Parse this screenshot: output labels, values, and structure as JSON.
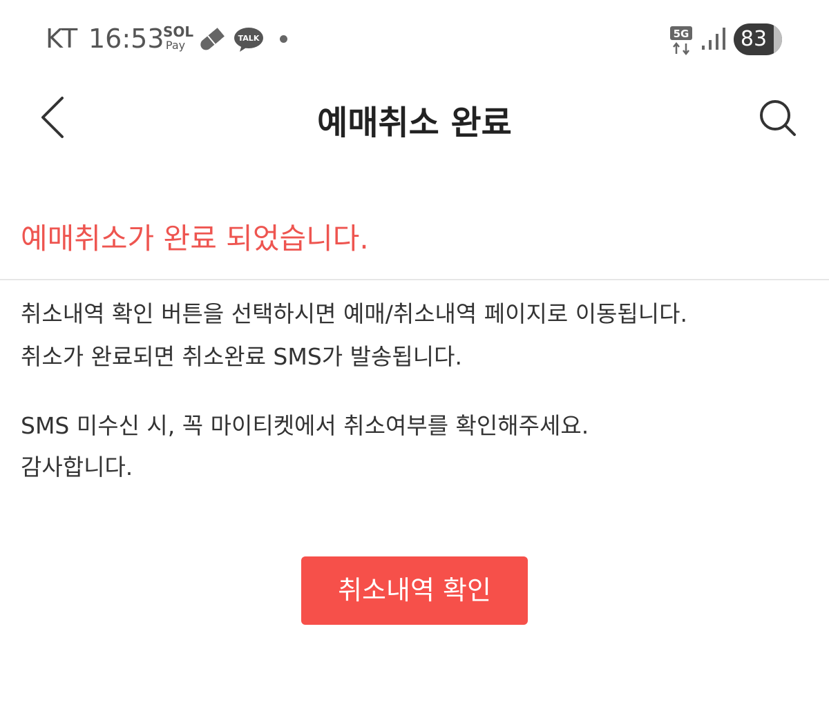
{
  "status_bar": {
    "carrier": "KT",
    "time": "16:53",
    "sol_pay_top": "SOL",
    "sol_pay_bottom": "Pay",
    "talk_label": "TALK",
    "network": "5G",
    "battery_level": "83",
    "battery_fraction": 0.83,
    "icons": [
      "sol-pay-icon",
      "pill-icon",
      "kakaotalk-icon",
      "notification-dot-icon",
      "5g-data-icon",
      "signal-icon",
      "battery-icon"
    ]
  },
  "header": {
    "title": "예매취소 완료",
    "back_icon": "chevron-left-icon",
    "search_icon": "search-icon"
  },
  "notice": {
    "headline": "예매취소가 완료 되었습니다.",
    "lines": [
      "취소내역 확인 버튼을 선택하시면 예매/취소내역 페이지로 이동됩니다.",
      "취소가 완료되면 취소완료 SMS가 발송됩니다.",
      "SMS 미수신 시, 꼭 마이티켓에서 취소여부를 확인해주세요.",
      "감사합니다."
    ]
  },
  "actions": {
    "history_button": "취소내역 확인"
  },
  "colors": {
    "accent": "#f6504a",
    "headline": "#ee5550",
    "text": "#333333"
  }
}
